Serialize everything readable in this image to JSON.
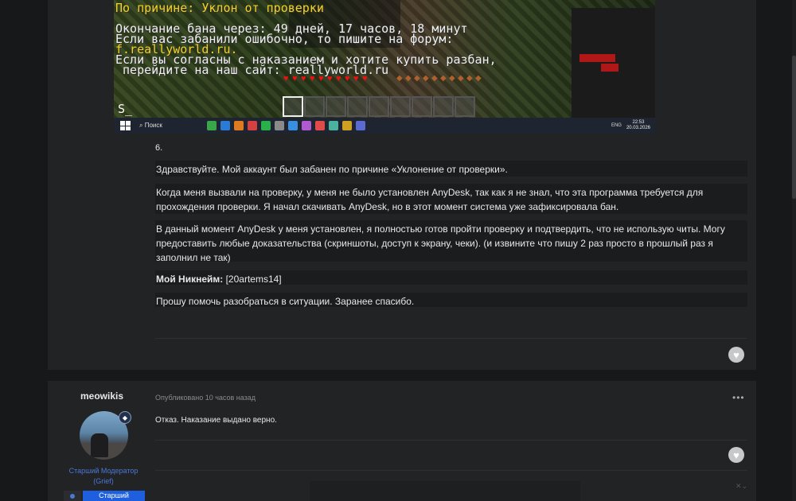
{
  "screenshot": {
    "ban_lines": [
      "По причине: Уклон от проверки",
      "Окончание бана через: 49 дней, 17 часов, 18 минут",
      "Если вас забанили ошибочно, то пишите на форум:",
      "f.reallyworld.ru.",
      "Если вы согласны с наказанием и хотите купить разбан,",
      " перейдите на наш сайт: reallyworld.ru"
    ],
    "chat_prompt": "S_",
    "taskbar": {
      "search_label": "Поиск",
      "lang": "ENG",
      "time": "22:53",
      "date": "20.03.2026"
    }
  },
  "post1": {
    "number": "6.",
    "paragraphs": [
      "Здравствуйте. Мой аккаунт был забанен по причине «Уклонение от проверки».",
      "Когда меня вызвали на проверку, у меня не было установлен AnyDesk, так как я не знал, что эта программа требуется для прохождения проверки. Я начал скачивать AnyDesk, но в этот момент система уже зафиксировала бан.",
      "В данный момент AnyDesk у меня установлен, я полностью готов пройти проверку и подтвердить, что не использую читы. Могу предоставить любые доказательства (скриншоты, доступ к экрану, чеки). (и извините что пишу 2 раз просто в прошлый раз я заполнил не так)"
    ],
    "nickname_label": "Мой Никнейм:",
    "nickname_value": " [20artems14]",
    "closing": "Прошу помочь разобраться в ситуации. Заранее спасибо."
  },
  "post2": {
    "author": "meowikis",
    "role_line1": "Старший Модератор",
    "role_line2": "(Grief)",
    "role_badge": "Старший",
    "posted": "Опубликовано 10 часов назад",
    "menu": "•••",
    "reply": "Отказ. Наказание выдано верно."
  },
  "colors": {
    "accent": "#1e5fe0",
    "role_text": "#4a78d8",
    "ban_highlight": "#f3d21e",
    "hearts": "#e11111"
  }
}
